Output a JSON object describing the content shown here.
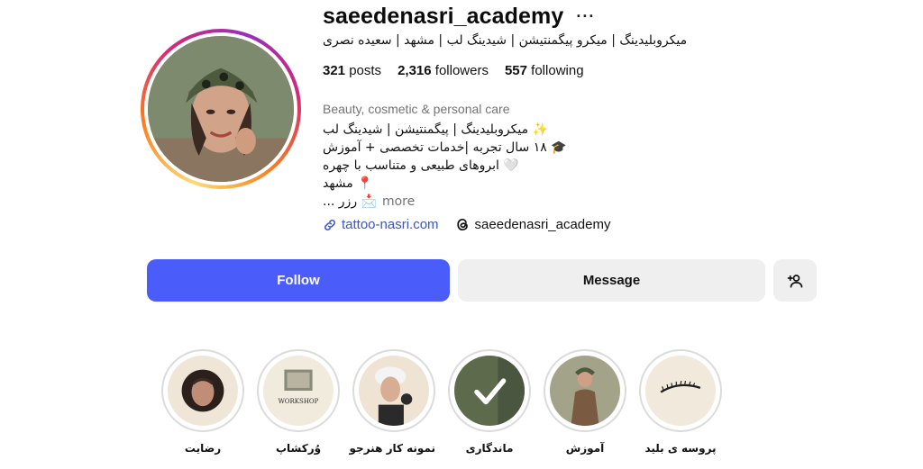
{
  "profile": {
    "username": "saeedenasri_academy",
    "more_icon": "ellipsis-icon",
    "full_name": "میکروبلیدینگ | میکرو پیگمنتیشن | شیدینگ لب | مشهد | سعیده نصری",
    "stats": {
      "posts_count": "321",
      "posts_label": "posts",
      "followers_count": "2,316",
      "followers_label": "followers",
      "following_count": "557",
      "following_label": "following"
    },
    "category": "Beauty, cosmetic & personal care",
    "bio": {
      "line1": "✨ میکروبلیدینگ | پیگمنتیشن | شیدینگ لب",
      "line2": "🎓 ۱۸ سال تجربه |خدمات تخصصی + آموزش",
      "line3": "🤍 ابروهای طبیعی و متناسب با چهره",
      "line4": "📍 مشهد",
      "line5": "📩 رزر ...",
      "more_label": "more"
    },
    "website": "tattoo-nasri.com",
    "threads_handle": "saeedenasri_academy"
  },
  "actions": {
    "follow_label": "Follow",
    "message_label": "Message",
    "add_user_icon": "add-user-icon"
  },
  "highlights": [
    {
      "label": "رضایت"
    },
    {
      "label": "وُرکشاپ",
      "image_text": "WORKSHOP"
    },
    {
      "label": "نمونه کار هنرجو"
    },
    {
      "label": "ماندگاری"
    },
    {
      "label": "آموزش"
    },
    {
      "label": "پروسه ی بلید"
    }
  ],
  "colors": {
    "follow_button": "#4a5dfa",
    "secondary_button": "#efefef",
    "link": "#3a55c9",
    "muted_text": "#737373"
  }
}
